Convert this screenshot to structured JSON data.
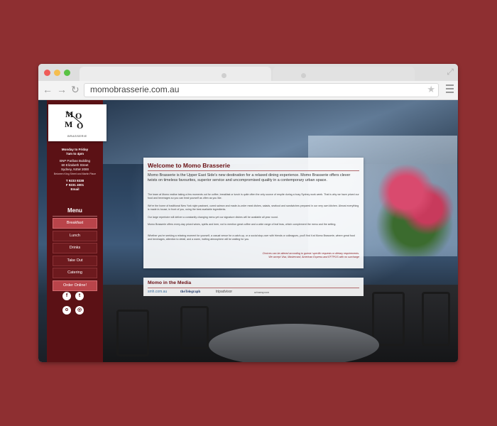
{
  "browser": {
    "url": "momobrasserie.com.au"
  },
  "logo": {
    "letters": [
      "M",
      "O",
      "M",
      "O"
    ],
    "subtitle": "BRASSERIE"
  },
  "info": {
    "hours_days": "Monday to Friday",
    "hours_time": "7am to 4pm",
    "building": "BNP Paribas Building",
    "street": "60 Elizabeth Street",
    "city": "Sydney, NSW 2000",
    "between": "Between King Street and Martin Place",
    "phone": "T 9233 8338",
    "fax": "F 9231 4001",
    "email": "Email"
  },
  "menu": {
    "title": "Menu",
    "items": [
      {
        "label": "Breakfast",
        "active": true
      },
      {
        "label": "Lunch",
        "active": false
      },
      {
        "label": "Drinks",
        "active": false
      },
      {
        "label": "Take Out",
        "active": false
      },
      {
        "label": "Catering",
        "active": false
      },
      {
        "label": "Order Online!",
        "active": true
      }
    ]
  },
  "social": {
    "facebook": "f",
    "twitter": "t",
    "tripadvisor": "o",
    "instagram": "◎"
  },
  "welcome": {
    "title": "Welcome to Momo Brasserie",
    "lead": "Momo Brasserie is the Upper East Side's new destination for a relaxed dining experience. Momo Brasserie offers clever twists on timeless favourites, superior service and uncompromised quality in a contemporary urban space.",
    "p1": "The team at Momo realise taking a few moments out for coffee, breakfast or lunch is quite often the only source of respite during a busy Sydney work week. That is why we have priced our food and beverages so you can treat yourself as often as you like.",
    "p2": "We're the home of traditional New York style pastrami, cured salmon and made-to-order meat dishes, salads, seafood and sandwiches prepared in our very own kitchen. Almost everything is made in-house, in front of you, using the best available ingredients.",
    "p3": "Our large repertoire will deliver a constantly changing menu yet our signature dishes will be available all year round.",
    "p4": "Momo Brasserie offers every-day priced wines, spirits and beer, not to mention great coffee and a wide range of leaf teas, which complement the menu and the setting.",
    "p5": "Whether you're seeking a relaxing moment for yourself, a casual venue for a catch-up, or a social stop-over with friends or colleagues, you'll find it at Momo Brasserie, where great food and beverages, attention to detail, and a warm, inviting atmosphere will be waiting for you.",
    "note1": "Choices can be altered according to guests' specific requests or dietary requirements.",
    "note2": "We accept Visa, Mastercard, American Express and EFTPOS with no surcharge"
  },
  "media": {
    "title": "Momo in the Media",
    "logos": [
      "smh.com.au",
      "theTelegraph",
      "tripadvisor",
      "urbanspoon"
    ]
  }
}
